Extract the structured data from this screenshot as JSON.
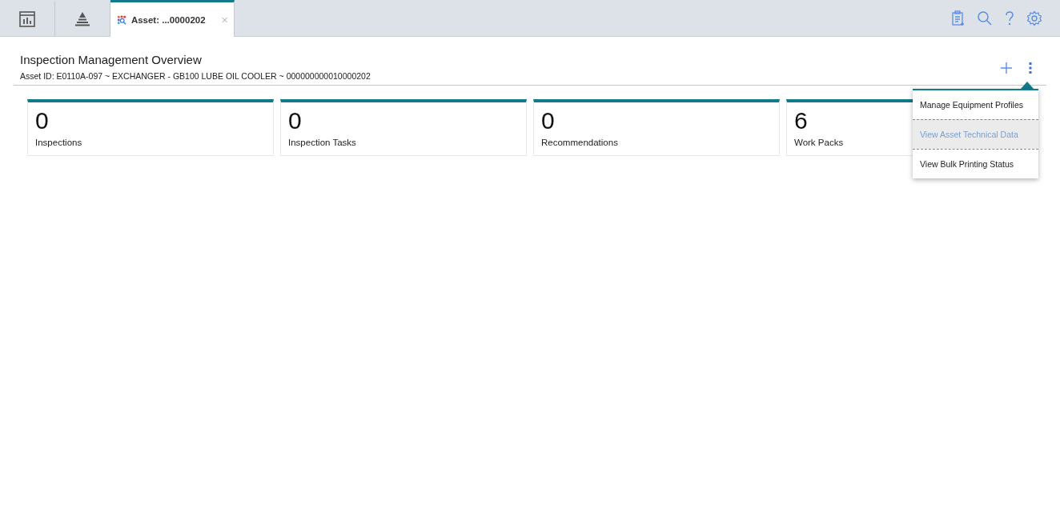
{
  "tabs": [
    {
      "kind": "report",
      "selected": false
    },
    {
      "kind": "pyramid",
      "selected": false
    },
    {
      "kind": "asset",
      "label": "Asset: ...0000202",
      "selected": true
    }
  ],
  "page": {
    "title": "Inspection Management Overview",
    "subtitle": "Asset ID: E0110A-097 ~ EXCHANGER - GB100 LUBE OIL COOLER ~ 000000000010000202"
  },
  "cards": [
    {
      "value": "0",
      "label": "Inspections"
    },
    {
      "value": "0",
      "label": "Inspection Tasks"
    },
    {
      "value": "0",
      "label": "Recommendations"
    },
    {
      "value": "6",
      "label": "Work Packs"
    }
  ],
  "menu": {
    "items": [
      {
        "label": "Manage Equipment Profiles",
        "highlighted": false
      },
      {
        "label": "View Asset Technical Data",
        "highlighted": true
      },
      {
        "label": "View Bulk Printing Status",
        "highlighted": false
      }
    ]
  }
}
